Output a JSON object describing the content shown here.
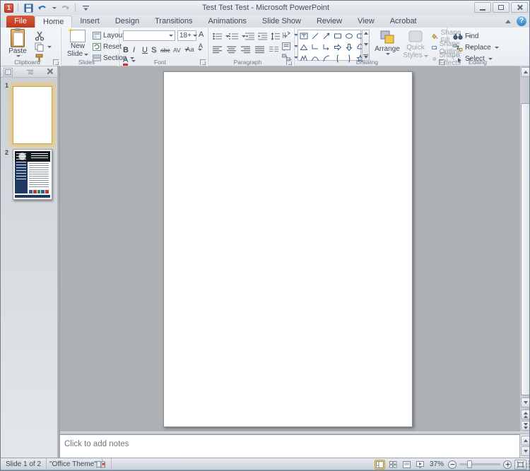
{
  "titlebar": {
    "title": "Test Test Test - Microsoft PowerPoint",
    "help_glyph": "?"
  },
  "tabs": {
    "file": "File",
    "items": [
      "Home",
      "Insert",
      "Design",
      "Transitions",
      "Animations",
      "Slide Show",
      "Review",
      "View",
      "Acrobat"
    ],
    "selected": "Home"
  },
  "ribbon": {
    "clipboard": {
      "label": "Clipboard",
      "paste": "Paste"
    },
    "slides": {
      "label": "Slides",
      "new_line1": "New",
      "new_line2": "Slide",
      "layout": "Layout",
      "reset": "Reset",
      "section": "Section"
    },
    "font": {
      "label": "Font",
      "size": "18+",
      "bold": "B",
      "italic": "I",
      "underline": "U",
      "strike": "S",
      "strike_abc": "abc",
      "spacing": "AV",
      "case": "Aa",
      "color": "A",
      "grow": "A",
      "shrink": "A"
    },
    "paragraph": {
      "label": "Paragraph"
    },
    "drawing": {
      "label": "Drawing",
      "arrange": "Arrange",
      "quick_line1": "Quick",
      "quick_line2": "Styles",
      "shape_fill": "Shape Fill",
      "shape_outline": "Shape Outline",
      "shape_effects": "Shape Effects"
    },
    "editing": {
      "label": "Editing",
      "find": "Find",
      "replace": "Replace",
      "select": "Select"
    }
  },
  "slides_panel": {
    "slide1_num": "1",
    "slide2_num": "2"
  },
  "notes": {
    "placeholder": "Click to add notes"
  },
  "status": {
    "slide_indicator": "Slide 1 of 2",
    "theme": "\"Office Theme\"",
    "zoom": "37%"
  },
  "colors": {
    "file_tab": "#c8432c",
    "selection_glow": "#f4c45c",
    "navy": "#1f3864",
    "workspace": "#aeb1b4"
  }
}
